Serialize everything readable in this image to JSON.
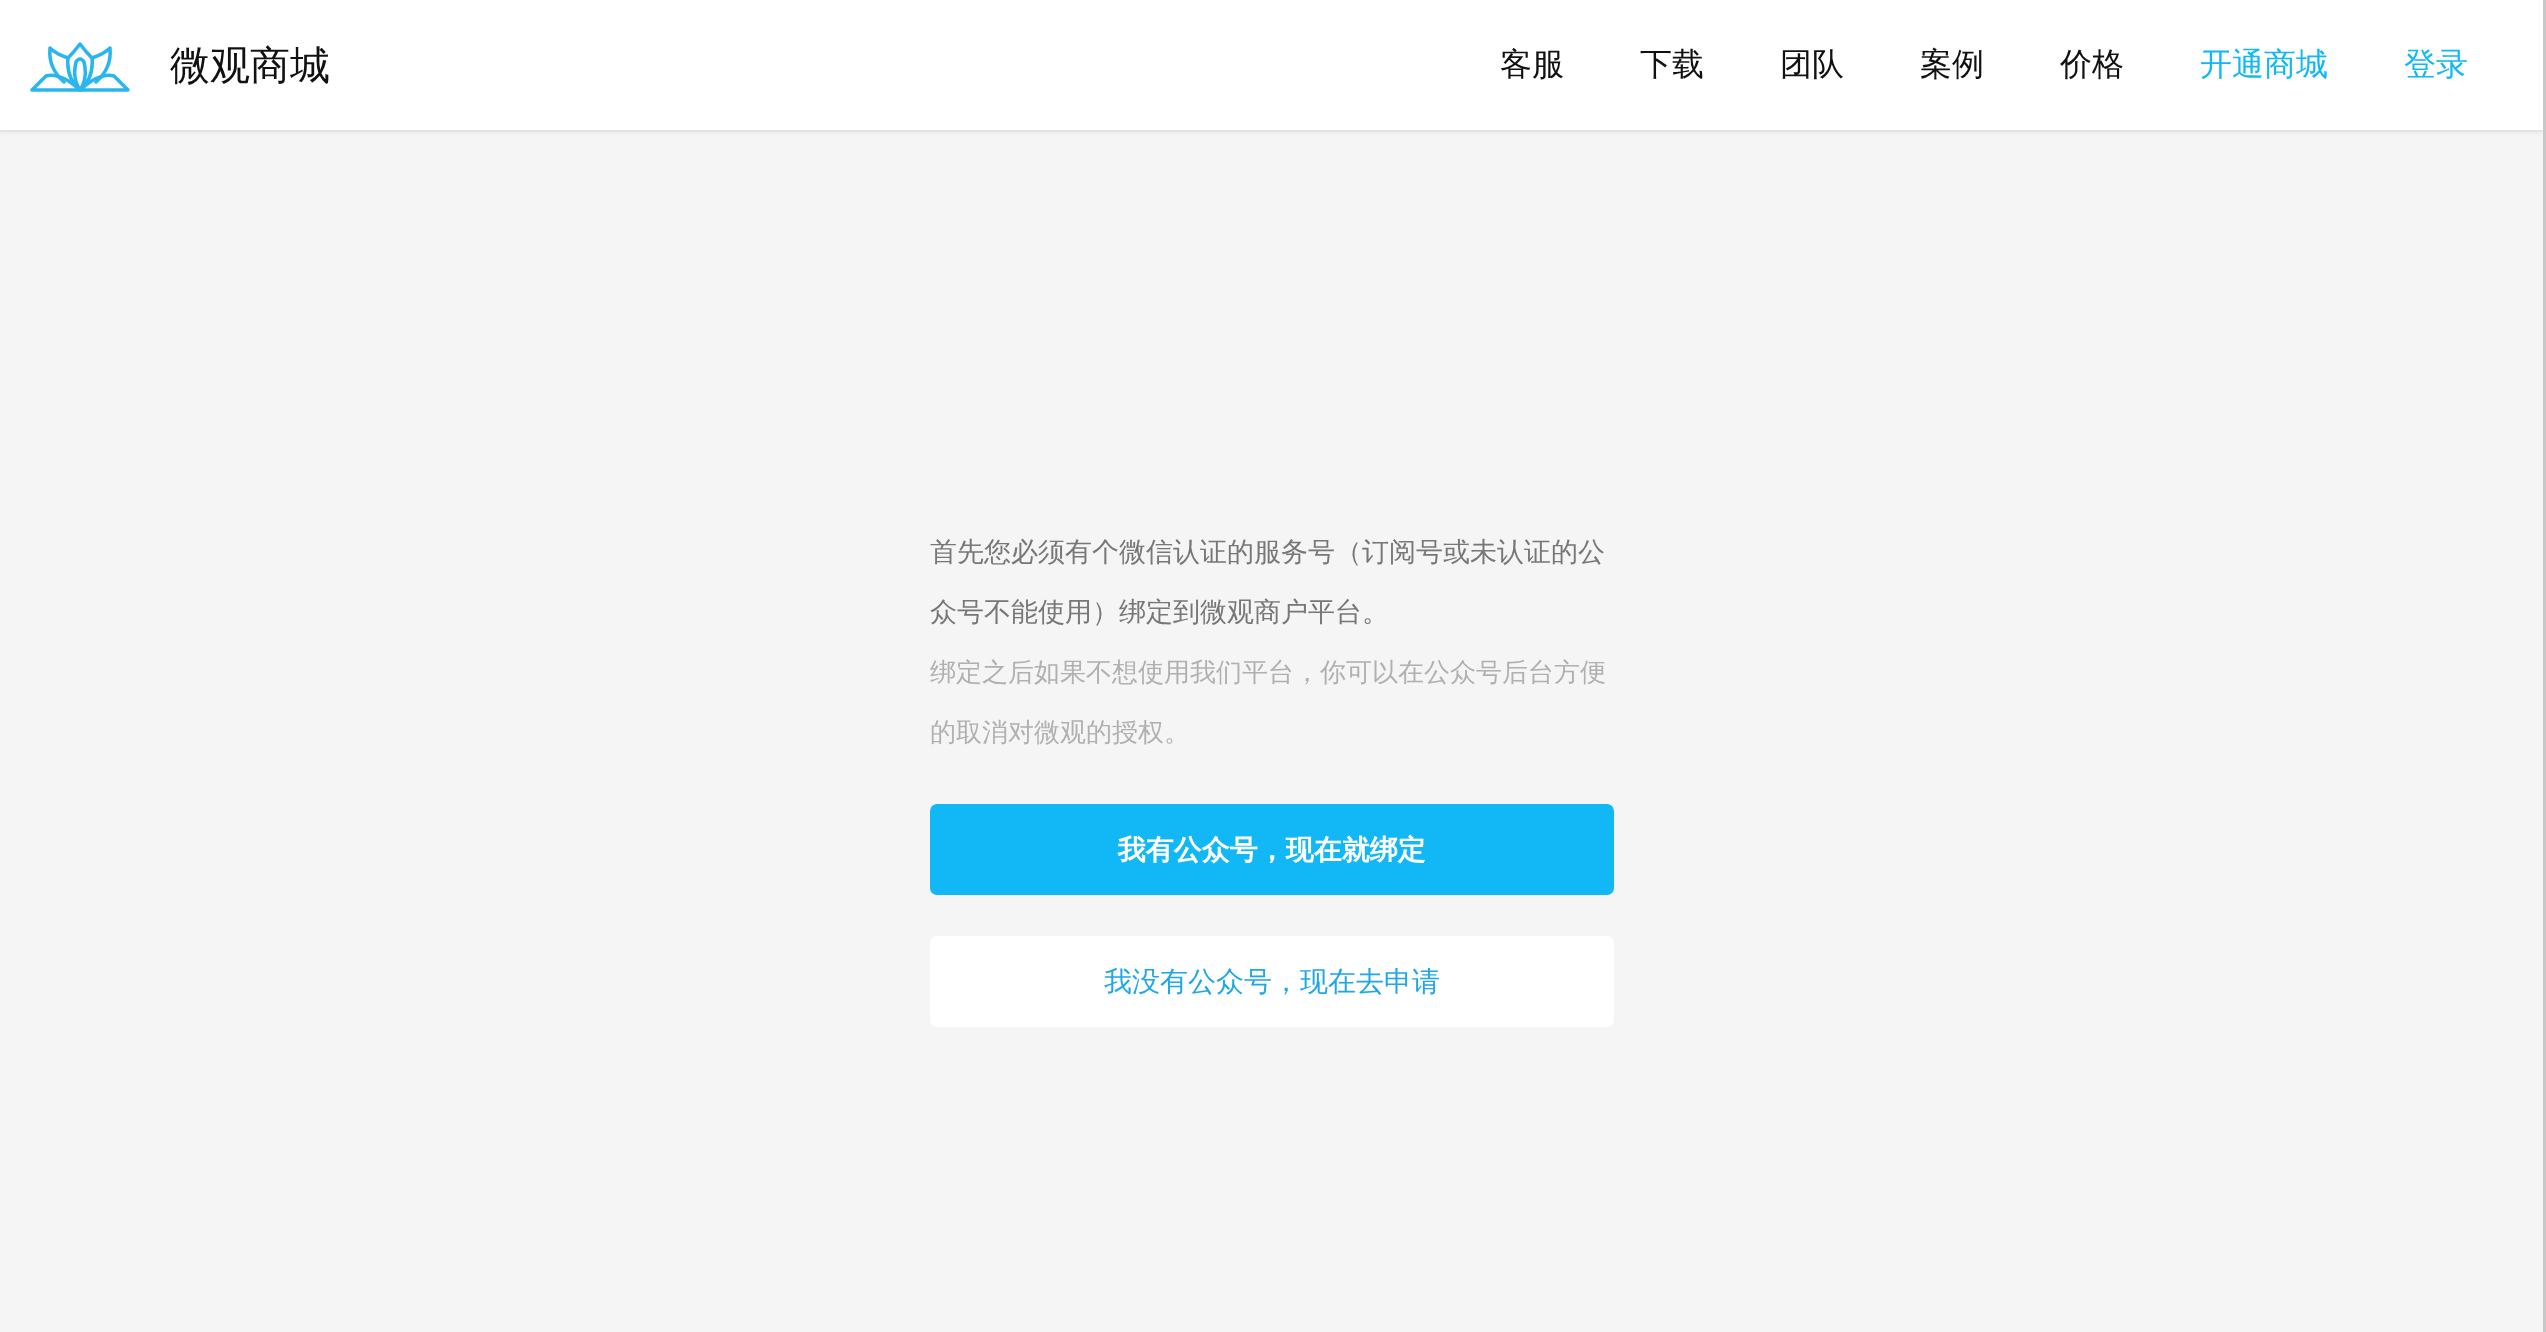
{
  "header": {
    "brand": "微观商城",
    "nav": [
      {
        "label": "客服",
        "highlighted": false
      },
      {
        "label": "下载",
        "highlighted": false
      },
      {
        "label": "团队",
        "highlighted": false
      },
      {
        "label": "案例",
        "highlighted": false
      },
      {
        "label": "价格",
        "highlighted": false
      },
      {
        "label": "开通商城",
        "highlighted": true
      },
      {
        "label": "登录",
        "highlighted": true
      }
    ]
  },
  "content": {
    "notice": "首先您必须有个微信认证的服务号（订阅号或未认证的公众号不能使用）绑定到微观商户平台。",
    "hint": "绑定之后如果不想使用我们平台，你可以在公众号后台方便的取消对微观的授权。",
    "buttons": [
      {
        "label": "我有公众号，现在就绑定",
        "kind": "primary"
      },
      {
        "label": "我没有公众号，现在去申请",
        "kind": "secondary"
      }
    ]
  }
}
